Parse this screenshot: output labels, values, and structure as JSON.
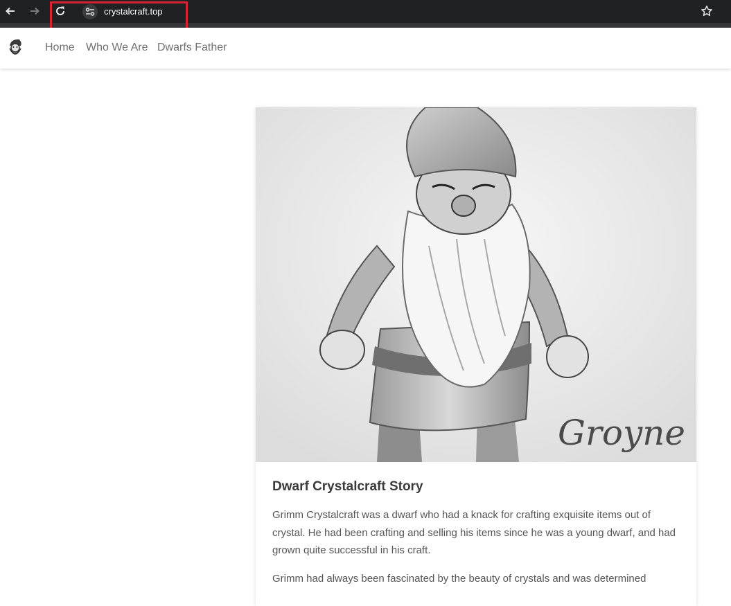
{
  "browser": {
    "url": "crystalcraft.top",
    "back_icon": "arrow-left-icon",
    "forward_icon": "arrow-right-icon",
    "reload_icon": "reload-icon",
    "site_info_icon": "tune-icon",
    "bookmark_icon": "star-icon",
    "highlight_color": "#d62431"
  },
  "header": {
    "logo_icon": "gnome-logo-icon",
    "nav": [
      {
        "label": "Home"
      },
      {
        "label": "Who We Are"
      },
      {
        "label": "Dwarfs Father"
      }
    ]
  },
  "card": {
    "image_signature": "Groyne",
    "title": "Dwarf Crystalcraft Story",
    "paragraphs": [
      "Grimm Crystalcraft was a dwarf who had a knack for crafting exquisite items out of crystal. He had been crafting and selling his items since he was a young dwarf, and had grown quite successful in his craft.",
      "Grimm had always been fascinated by the beauty of crystals and was determined"
    ]
  }
}
